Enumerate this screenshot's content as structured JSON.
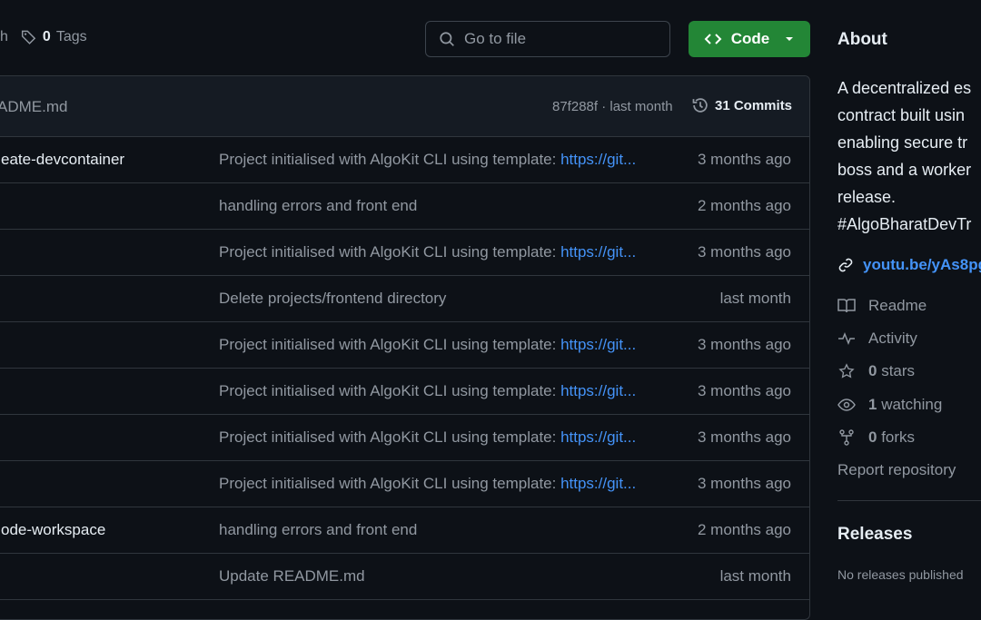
{
  "header": {
    "branch_tail": "h",
    "tags_count": "0",
    "tags_label": "Tags",
    "search_placeholder": "Go to file",
    "code_label": "Code"
  },
  "commit_bar": {
    "message": "ADME.md",
    "hash_time": "87f288f · last month",
    "commits": "31 Commits"
  },
  "files": [
    {
      "name": "eate-devcontainer",
      "msg": "Project initialised with AlgoKit CLI using template: ",
      "link": "https://git...",
      "date": "3 months ago"
    },
    {
      "name": "",
      "msg": "handling errors and front end",
      "link": "",
      "date": "2 months ago"
    },
    {
      "name": "",
      "msg": "Project initialised with AlgoKit CLI using template: ",
      "link": "https://git...",
      "date": "3 months ago"
    },
    {
      "name": "",
      "msg": "Delete projects/frontend directory",
      "link": "",
      "date": "last month"
    },
    {
      "name": "",
      "msg": "Project initialised with AlgoKit CLI using template: ",
      "link": "https://git...",
      "date": "3 months ago"
    },
    {
      "name": "",
      "msg": "Project initialised with AlgoKit CLI using template: ",
      "link": "https://git...",
      "date": "3 months ago"
    },
    {
      "name": "",
      "msg": "Project initialised with AlgoKit CLI using template: ",
      "link": "https://git...",
      "date": "3 months ago"
    },
    {
      "name": "",
      "msg": "Project initialised with AlgoKit CLI using template: ",
      "link": "https://git...",
      "date": "3 months ago"
    },
    {
      "name": "ode-workspace",
      "msg": "handling errors and front end",
      "link": "",
      "date": "2 months ago"
    },
    {
      "name": "",
      "msg": "Update README.md",
      "link": "",
      "date": "last month"
    }
  ],
  "about": {
    "title": "About",
    "description": "A decentralized es\ncontract built usin\nenabling secure tr\nboss and a worker\nrelease.\n#AlgoBharatDevTr",
    "website": "youtu.be/yAs8pg",
    "readme": "Readme",
    "activity": "Activity",
    "stars_count": "0",
    "stars": "stars",
    "watching_count": "1",
    "watching": "watching",
    "forks_count": "0",
    "forks": "forks",
    "report": "Report repository"
  },
  "releases": {
    "title": "Releases",
    "empty": "No releases published"
  },
  "colors": {
    "bg": "#0d1117",
    "accent_green": "#238636",
    "link": "#4493f8",
    "border": "#30363d"
  }
}
